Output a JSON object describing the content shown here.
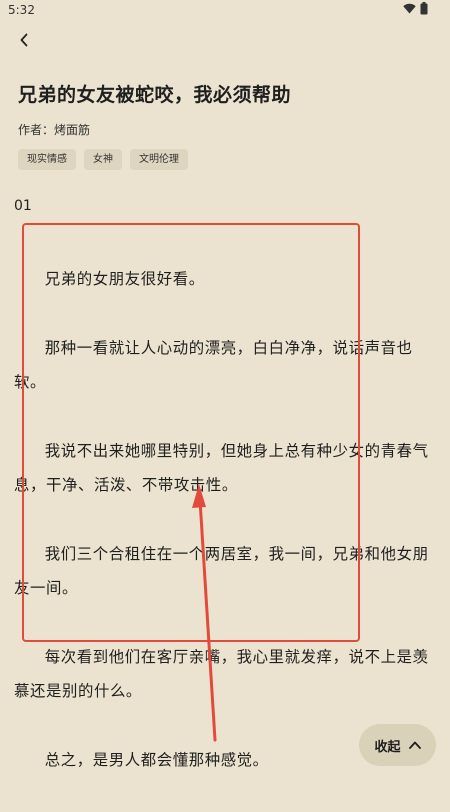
{
  "status_bar": {
    "time": "5:32"
  },
  "article": {
    "title": "兄弟的女友被蛇咬，我必须帮助",
    "author": "作者：烤面筋",
    "tags": [
      "现实情感",
      "女神",
      "文明伦理"
    ],
    "chapter": "01",
    "paragraphs": [
      "兄弟的女朋友很好看。",
      "那种一看就让人心动的漂亮，白白净净，说话声音也软。",
      "我说不出来她哪里特别，但她身上总有种少女的青春气息，干净、活泼、不带攻击性。",
      "我们三个合租住在一个两居室，我一间，兄弟和他女朋友一间。",
      "每次看到他们在客厅亲嘴，我心里就发痒，说不上是羡慕还是别的什么。",
      "总之，是男人都会懂那种感觉。"
    ]
  },
  "collapse_button": {
    "label": "收起"
  },
  "icons": {
    "back": "back-arrow-icon",
    "wifi": "wifi-icon",
    "battery": "battery-icon",
    "chevron": "chevron-up-icon"
  },
  "annotation_color": "#e24b3b"
}
